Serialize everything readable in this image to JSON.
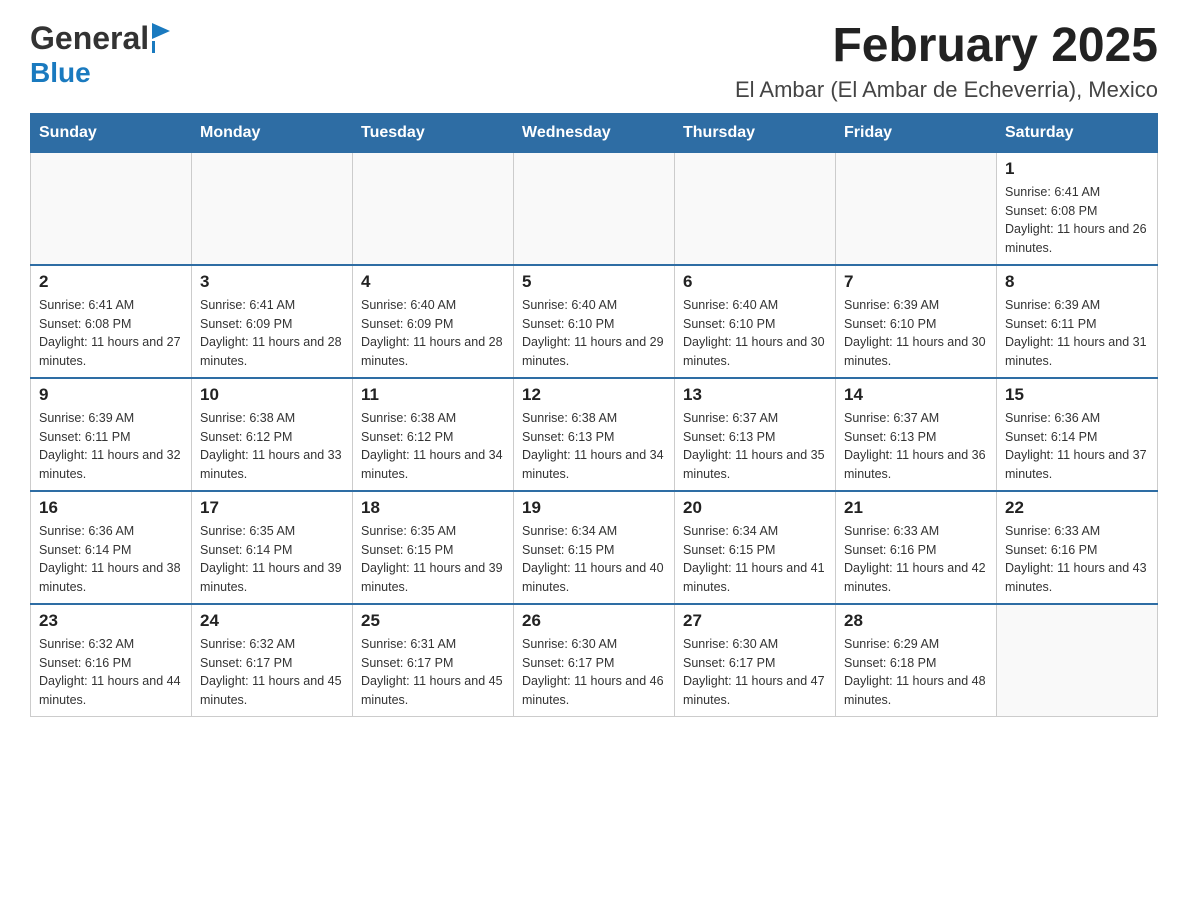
{
  "header": {
    "logo_general": "General",
    "logo_blue": "Blue",
    "title": "February 2025",
    "subtitle": "El Ambar (El Ambar de Echeverria), Mexico"
  },
  "days_of_week": [
    "Sunday",
    "Monday",
    "Tuesday",
    "Wednesday",
    "Thursday",
    "Friday",
    "Saturday"
  ],
  "weeks": [
    [
      {
        "day": "",
        "sunrise": "",
        "sunset": "",
        "daylight": ""
      },
      {
        "day": "",
        "sunrise": "",
        "sunset": "",
        "daylight": ""
      },
      {
        "day": "",
        "sunrise": "",
        "sunset": "",
        "daylight": ""
      },
      {
        "day": "",
        "sunrise": "",
        "sunset": "",
        "daylight": ""
      },
      {
        "day": "",
        "sunrise": "",
        "sunset": "",
        "daylight": ""
      },
      {
        "day": "",
        "sunrise": "",
        "sunset": "",
        "daylight": ""
      },
      {
        "day": "1",
        "sunrise": "Sunrise: 6:41 AM",
        "sunset": "Sunset: 6:08 PM",
        "daylight": "Daylight: 11 hours and 26 minutes."
      }
    ],
    [
      {
        "day": "2",
        "sunrise": "Sunrise: 6:41 AM",
        "sunset": "Sunset: 6:08 PM",
        "daylight": "Daylight: 11 hours and 27 minutes."
      },
      {
        "day": "3",
        "sunrise": "Sunrise: 6:41 AM",
        "sunset": "Sunset: 6:09 PM",
        "daylight": "Daylight: 11 hours and 28 minutes."
      },
      {
        "day": "4",
        "sunrise": "Sunrise: 6:40 AM",
        "sunset": "Sunset: 6:09 PM",
        "daylight": "Daylight: 11 hours and 28 minutes."
      },
      {
        "day": "5",
        "sunrise": "Sunrise: 6:40 AM",
        "sunset": "Sunset: 6:10 PM",
        "daylight": "Daylight: 11 hours and 29 minutes."
      },
      {
        "day": "6",
        "sunrise": "Sunrise: 6:40 AM",
        "sunset": "Sunset: 6:10 PM",
        "daylight": "Daylight: 11 hours and 30 minutes."
      },
      {
        "day": "7",
        "sunrise": "Sunrise: 6:39 AM",
        "sunset": "Sunset: 6:10 PM",
        "daylight": "Daylight: 11 hours and 30 minutes."
      },
      {
        "day": "8",
        "sunrise": "Sunrise: 6:39 AM",
        "sunset": "Sunset: 6:11 PM",
        "daylight": "Daylight: 11 hours and 31 minutes."
      }
    ],
    [
      {
        "day": "9",
        "sunrise": "Sunrise: 6:39 AM",
        "sunset": "Sunset: 6:11 PM",
        "daylight": "Daylight: 11 hours and 32 minutes."
      },
      {
        "day": "10",
        "sunrise": "Sunrise: 6:38 AM",
        "sunset": "Sunset: 6:12 PM",
        "daylight": "Daylight: 11 hours and 33 minutes."
      },
      {
        "day": "11",
        "sunrise": "Sunrise: 6:38 AM",
        "sunset": "Sunset: 6:12 PM",
        "daylight": "Daylight: 11 hours and 34 minutes."
      },
      {
        "day": "12",
        "sunrise": "Sunrise: 6:38 AM",
        "sunset": "Sunset: 6:13 PM",
        "daylight": "Daylight: 11 hours and 34 minutes."
      },
      {
        "day": "13",
        "sunrise": "Sunrise: 6:37 AM",
        "sunset": "Sunset: 6:13 PM",
        "daylight": "Daylight: 11 hours and 35 minutes."
      },
      {
        "day": "14",
        "sunrise": "Sunrise: 6:37 AM",
        "sunset": "Sunset: 6:13 PM",
        "daylight": "Daylight: 11 hours and 36 minutes."
      },
      {
        "day": "15",
        "sunrise": "Sunrise: 6:36 AM",
        "sunset": "Sunset: 6:14 PM",
        "daylight": "Daylight: 11 hours and 37 minutes."
      }
    ],
    [
      {
        "day": "16",
        "sunrise": "Sunrise: 6:36 AM",
        "sunset": "Sunset: 6:14 PM",
        "daylight": "Daylight: 11 hours and 38 minutes."
      },
      {
        "day": "17",
        "sunrise": "Sunrise: 6:35 AM",
        "sunset": "Sunset: 6:14 PM",
        "daylight": "Daylight: 11 hours and 39 minutes."
      },
      {
        "day": "18",
        "sunrise": "Sunrise: 6:35 AM",
        "sunset": "Sunset: 6:15 PM",
        "daylight": "Daylight: 11 hours and 39 minutes."
      },
      {
        "day": "19",
        "sunrise": "Sunrise: 6:34 AM",
        "sunset": "Sunset: 6:15 PM",
        "daylight": "Daylight: 11 hours and 40 minutes."
      },
      {
        "day": "20",
        "sunrise": "Sunrise: 6:34 AM",
        "sunset": "Sunset: 6:15 PM",
        "daylight": "Daylight: 11 hours and 41 minutes."
      },
      {
        "day": "21",
        "sunrise": "Sunrise: 6:33 AM",
        "sunset": "Sunset: 6:16 PM",
        "daylight": "Daylight: 11 hours and 42 minutes."
      },
      {
        "day": "22",
        "sunrise": "Sunrise: 6:33 AM",
        "sunset": "Sunset: 6:16 PM",
        "daylight": "Daylight: 11 hours and 43 minutes."
      }
    ],
    [
      {
        "day": "23",
        "sunrise": "Sunrise: 6:32 AM",
        "sunset": "Sunset: 6:16 PM",
        "daylight": "Daylight: 11 hours and 44 minutes."
      },
      {
        "day": "24",
        "sunrise": "Sunrise: 6:32 AM",
        "sunset": "Sunset: 6:17 PM",
        "daylight": "Daylight: 11 hours and 45 minutes."
      },
      {
        "day": "25",
        "sunrise": "Sunrise: 6:31 AM",
        "sunset": "Sunset: 6:17 PM",
        "daylight": "Daylight: 11 hours and 45 minutes."
      },
      {
        "day": "26",
        "sunrise": "Sunrise: 6:30 AM",
        "sunset": "Sunset: 6:17 PM",
        "daylight": "Daylight: 11 hours and 46 minutes."
      },
      {
        "day": "27",
        "sunrise": "Sunrise: 6:30 AM",
        "sunset": "Sunset: 6:17 PM",
        "daylight": "Daylight: 11 hours and 47 minutes."
      },
      {
        "day": "28",
        "sunrise": "Sunrise: 6:29 AM",
        "sunset": "Sunset: 6:18 PM",
        "daylight": "Daylight: 11 hours and 48 minutes."
      },
      {
        "day": "",
        "sunrise": "",
        "sunset": "",
        "daylight": ""
      }
    ]
  ]
}
